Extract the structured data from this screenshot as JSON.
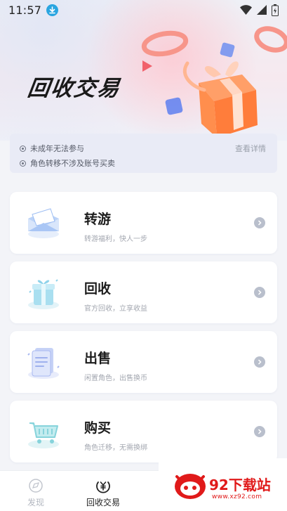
{
  "status_bar": {
    "time": "11:57"
  },
  "hero": {
    "title": "回收交易"
  },
  "notice": {
    "items": [
      "未成年无法参与",
      "角色转移不涉及账号买卖"
    ],
    "link": "查看详情"
  },
  "cards": [
    {
      "title": "转游",
      "subtitle": "转游福利，快人一步",
      "icon": "envelope-icon"
    },
    {
      "title": "回收",
      "subtitle": "官方回收，立享收益",
      "icon": "gift-box-icon"
    },
    {
      "title": "出售",
      "subtitle": "闲置角色，出售换币",
      "icon": "document-icon"
    },
    {
      "title": "购买",
      "subtitle": "角色迁移，无需换绑",
      "icon": "shopping-cart-icon"
    }
  ],
  "bottom_nav": {
    "items": [
      {
        "label": "发现",
        "icon": "discover-icon",
        "active": false
      },
      {
        "label": "回收交易",
        "icon": "yen-coin-icon",
        "active": true
      }
    ]
  },
  "watermark": {
    "name": "92下载站",
    "url": "www.xz92.com"
  },
  "colors": {
    "accent": "#1c1c1c",
    "watermark": "#e01a1a",
    "notice_bg": "#e9ebf6"
  }
}
